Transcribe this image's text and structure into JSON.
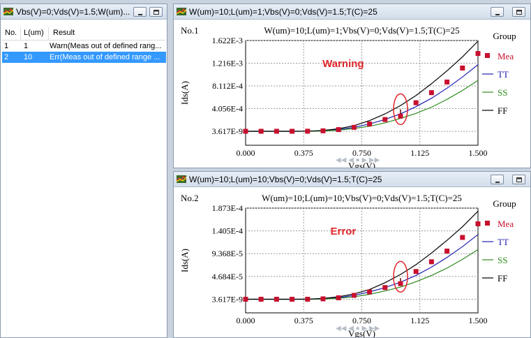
{
  "left_window": {
    "title": "Vbs(V)=0;Vds(V)=1.5;W(um)...",
    "columns": [
      "No.",
      "L(um)",
      "Result"
    ],
    "rows": [
      {
        "no": "1",
        "l": "1",
        "result": "Warn(Meas out of defined rang..."
      },
      {
        "no": "2",
        "l": "10",
        "result": "Err(Meas out of defined range ..."
      }
    ],
    "selected_row": 2
  },
  "plot1": {
    "window_title": "W(um)=10;L(um)=1;Vbs(V)=0;Vds(V)=1.5;T(C)=25",
    "label": "No.1",
    "annotation": "Warning",
    "legend_title": "Group",
    "nav": "◀◀ ◀ ● ▶ ▶▶"
  },
  "plot2": {
    "window_title": "W(um)=10;L(um)=10;Vbs(V)=0;Vds(V)=1.5;T(C)=25",
    "label": "No.2",
    "annotation": "Error",
    "legend_title": "Group",
    "nav": "◀◀ ◀ ● ▶ ▶▶"
  },
  "colors": {
    "mea": "#c8102e",
    "tt": "#1f1fb4",
    "ss": "#2e8b1e",
    "ff": "#000000",
    "annotation": "#e0262b",
    "selection": "#3399ff"
  },
  "chart_data": [
    {
      "type": "line",
      "title": "W(um)=10;L(um)=1;Vbs(V)=0;Vds(V)=1.5;T(C)=25",
      "xlabel": "Vgs(V)",
      "ylabel": "Ids(A)",
      "xlim": [
        0,
        1.5
      ],
      "ylim": [
        -2.5e-05,
        0.0001622
      ],
      "x_ticks": [
        "0.000",
        "0.375",
        "0.750",
        "1.125",
        "1.500"
      ],
      "y_ticks": [
        {
          "label": "3.617E-9",
          "value": 3.617e-09
        },
        {
          "label": "4.056E-4",
          "value": 4.056e-05
        },
        {
          "label": "8.112E-4",
          "value": 8.112e-05
        },
        {
          "label": "1.216E-3",
          "value": 0.0001216
        },
        {
          "label": "1.622E-3",
          "value": 0.0001622
        }
      ],
      "grid": true,
      "legend": "right",
      "x": [
        0,
        0.1,
        0.2,
        0.3,
        0.4,
        0.5,
        0.6,
        0.7,
        0.8,
        0.9,
        1.0,
        1.1,
        1.2,
        1.3,
        1.4,
        1.5
      ],
      "series": [
        {
          "name": "Mea",
          "style": "marker",
          "values": [
            0,
            0,
            0,
            0,
            1e-07,
            8e-07,
            3e-06,
            7e-06,
            1.3e-05,
            2.1e-05,
            2.7e-05,
            5.1e-05,
            6.9e-05,
            8.8e-05,
            0.000113,
            0.000139
          ]
        },
        {
          "name": "TT",
          "style": "line",
          "values": [
            0,
            0,
            0,
            0,
            1e-07,
            8e-07,
            3e-06,
            7e-06,
            1.3e-05,
            2.1e-05,
            3.1e-05,
            4.4e-05,
            5.9e-05,
            7.7e-05,
            9.7e-05,
            0.000119
          ]
        },
        {
          "name": "SS",
          "style": "line",
          "values": [
            0,
            0,
            0,
            0,
            0,
            4e-07,
            2e-06,
            5e-06,
            9e-06,
            1.5e-05,
            2.3e-05,
            3.2e-05,
            4.3e-05,
            5.7e-05,
            7.3e-05,
            9.1e-05
          ]
        },
        {
          "name": "FF",
          "style": "line",
          "values": [
            0,
            0,
            0,
            0,
            2e-07,
            1.4e-06,
            4.5e-06,
            1e-05,
            1.9e-05,
            3.1e-05,
            4.6e-05,
            6.4e-05,
            8.5e-05,
            0.000108,
            0.000133,
            0.000161
          ]
        }
      ],
      "highlight_x": 1.0
    },
    {
      "type": "line",
      "title": "W(um)=10;L(um)=10;Vbs(V)=0;Vds(V)=1.5;T(C)=25",
      "xlabel": "Vgs(V)",
      "ylabel": "Ids(A)",
      "xlim": [
        0,
        1.5
      ],
      "ylim": [
        -2.8e-06,
        1.873e-05
      ],
      "x_ticks": [
        "0.000",
        "0.375",
        "0.750",
        "1.125",
        "1.500"
      ],
      "y_ticks": [
        {
          "label": "3.617E-9",
          "value": 3.617e-09
        },
        {
          "label": "4.684E-5",
          "value": 4.684e-06
        },
        {
          "label": "9.368E-5",
          "value": 9.368e-06
        },
        {
          "label": "1.405E-4",
          "value": 1.405e-05
        },
        {
          "label": "1.873E-4",
          "value": 1.873e-05
        }
      ],
      "grid": true,
      "legend": "right",
      "x": [
        0,
        0.1,
        0.2,
        0.3,
        0.4,
        0.5,
        0.6,
        0.7,
        0.8,
        0.9,
        1.0,
        1.1,
        1.2,
        1.3,
        1.4,
        1.5
      ],
      "series": [
        {
          "name": "Mea",
          "style": "marker",
          "values": [
            0,
            0,
            0,
            0,
            0,
            8e-08,
            3e-07,
            8e-07,
            1.5e-06,
            2.4e-06,
            3.2e-06,
            5.7e-06,
            7.7e-06,
            9.9e-06,
            1.27e-05,
            1.55e-05
          ]
        },
        {
          "name": "TT",
          "style": "line",
          "values": [
            0,
            0,
            0,
            0,
            0,
            8e-08,
            3e-07,
            8e-07,
            1.5e-06,
            2.4e-06,
            3.5e-06,
            4.9e-06,
            6.6e-06,
            8.6e-06,
            1.08e-05,
            1.33e-05
          ]
        },
        {
          "name": "SS",
          "style": "line",
          "values": [
            0,
            0,
            0,
            0,
            0,
            4e-08,
            2e-07,
            5e-07,
            1e-06,
            1.7e-06,
            2.5e-06,
            3.6e-06,
            4.9e-06,
            6.4e-06,
            8.2e-06,
            1.02e-05
          ]
        },
        {
          "name": "FF",
          "style": "line",
          "values": [
            0,
            0,
            0,
            0,
            2e-08,
            1.5e-07,
            5e-07,
            1.1e-06,
            2e-06,
            3.4e-06,
            5.1e-06,
            7.1e-06,
            9.5e-06,
            1.21e-05,
            1.49e-05,
            1.81e-05
          ]
        }
      ],
      "highlight_x": 1.0
    }
  ]
}
